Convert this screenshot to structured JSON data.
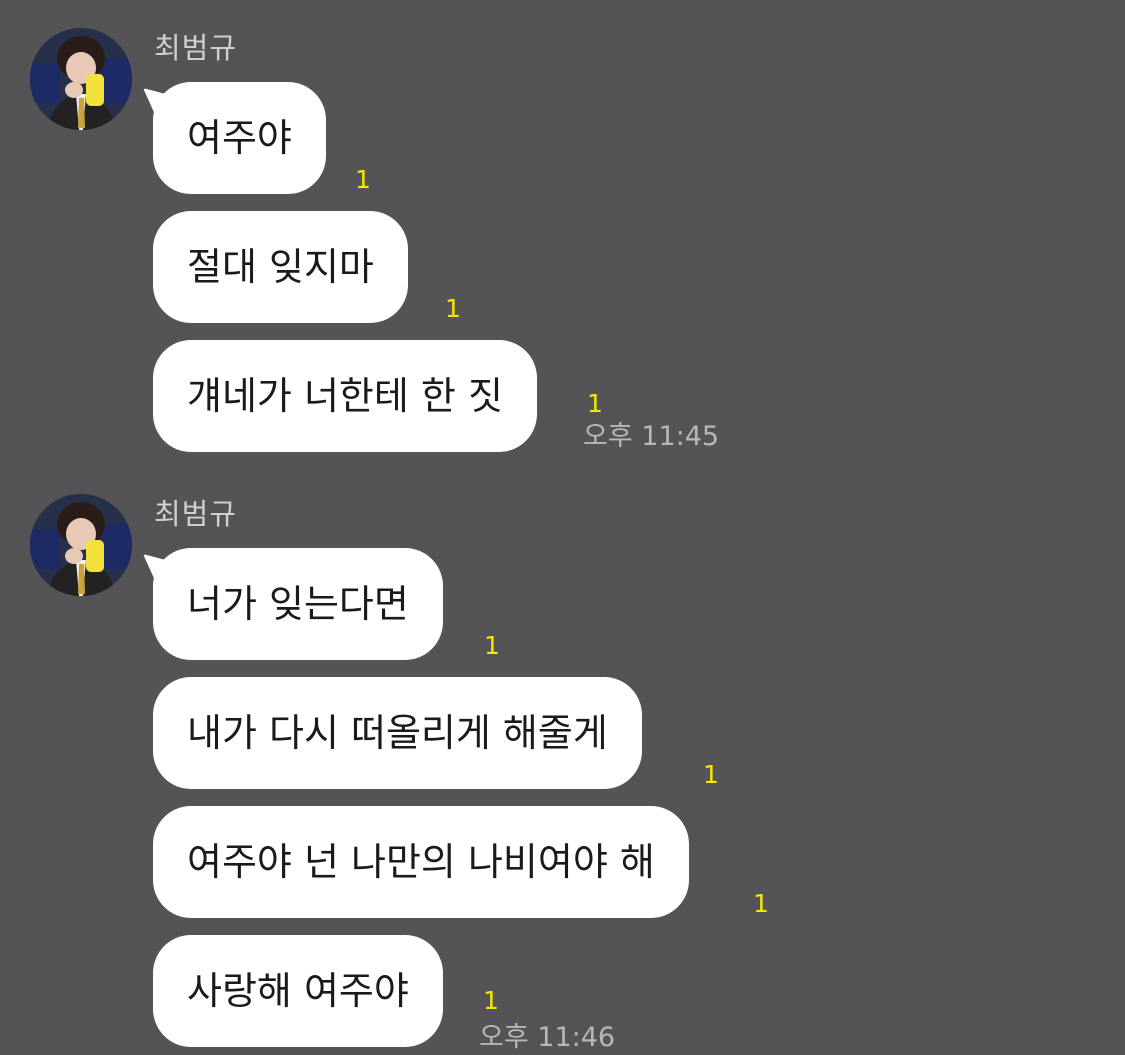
{
  "chat": {
    "groups": [
      {
        "sender": "최범규",
        "messages": [
          {
            "text": "여주야",
            "unread": "1"
          },
          {
            "text": "절대 잊지마",
            "unread": "1"
          },
          {
            "text": "걔네가 너한테 한 짓",
            "unread": "1",
            "time": "오후 11:45"
          }
        ]
      },
      {
        "sender": "최범규",
        "messages": [
          {
            "text": "너가 잊는다면",
            "unread": "1"
          },
          {
            "text": "내가 다시 떠올리게 해줄게",
            "unread": "1"
          },
          {
            "text": "여주야 넌 나만의 나비여야 해",
            "unread": "1"
          },
          {
            "text": "사랑해 여주야",
            "unread": "1",
            "time": "오후 11:46"
          }
        ]
      }
    ]
  },
  "colors": {
    "background": "#545356",
    "bubble": "#ffffff",
    "unread": "#f7e600",
    "time": "#b7b7ba",
    "sender": "#cfcfd1"
  }
}
